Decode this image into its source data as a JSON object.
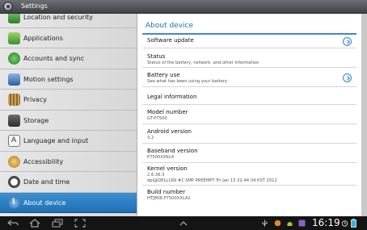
{
  "window": {
    "title": "Settings"
  },
  "sidebar": {
    "items": [
      {
        "label": "Location and security",
        "icon": "location-shield-icon"
      },
      {
        "label": "Applications",
        "icon": "applications-icon"
      },
      {
        "label": "Accounts and sync",
        "icon": "sync-icon"
      },
      {
        "label": "Motion settings",
        "icon": "motion-icon"
      },
      {
        "label": "Privacy",
        "icon": "privacy-icon"
      },
      {
        "label": "Storage",
        "icon": "storage-icon"
      },
      {
        "label": "Language and input",
        "icon": "language-icon"
      },
      {
        "label": "Accessibility",
        "icon": "accessibility-icon"
      },
      {
        "label": "Date and time",
        "icon": "clock-icon"
      },
      {
        "label": "About device",
        "icon": "info-icon",
        "selected": true
      }
    ]
  },
  "main": {
    "header": "About device",
    "software_update": {
      "title": "Software update"
    },
    "status": {
      "title": "Status",
      "subtitle": "Status of the battery, network, and other information"
    },
    "battery_use": {
      "title": "Battery use",
      "subtitle": "See what has been using your battery"
    },
    "legal": {
      "title": "Legal information"
    },
    "model": {
      "title": "Model number",
      "value": "GT-P7500"
    },
    "android": {
      "title": "Android version",
      "value": "3.2"
    },
    "baseband": {
      "title": "Baseband version",
      "value": "P7500XXKL4"
    },
    "kernel": {
      "title": "Kernel version",
      "value_line1": "2.6.36.3",
      "value_line2": "dpi@DELL169 #1 SMP PREEMPT Fri Jan 13 22:44:34 KST 2012"
    },
    "build": {
      "title": "Build number",
      "value": "HTJ85B.P7500XXLA2"
    }
  },
  "system_bar": {
    "time": "16:19",
    "colors": {
      "bar": "#141414",
      "accent": "#33b5e5"
    }
  }
}
